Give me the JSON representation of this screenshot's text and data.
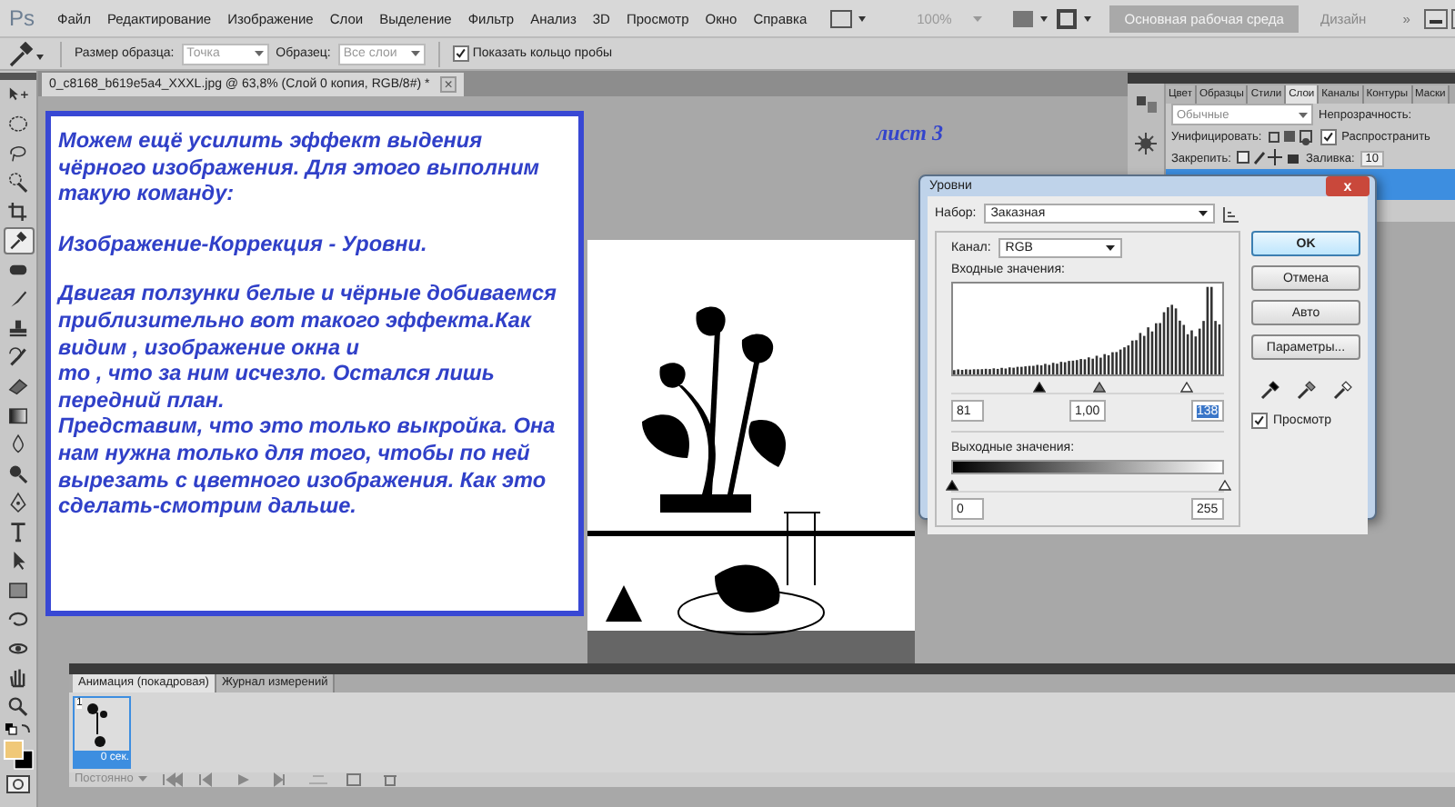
{
  "app_logo": "Ps",
  "menu": [
    "Файл",
    "Редактирование",
    "Изображение",
    "Слои",
    "Выделение",
    "Фильтр",
    "Анализ",
    "3D",
    "Просмотр",
    "Окно",
    "Справка"
  ],
  "zoom_menu": "100%",
  "workspaces": [
    {
      "label": "Основная рабочая среда",
      "selected": true
    },
    {
      "label": "Дизайн",
      "selected": false
    }
  ],
  "more_workspaces": "»",
  "options_bar": {
    "sample_size_label": "Размер образца:",
    "sample_size": "Точка",
    "sample_label": "Образец:",
    "sample": "Все слои",
    "show_ring": {
      "label": "Показать кольцо пробы",
      "checked": true
    }
  },
  "tools": [
    {
      "selected": false
    },
    {
      "selected": false
    },
    {
      "selected": false
    },
    {
      "selected": false
    },
    {
      "selected": false
    },
    {
      "selected": true
    },
    {
      "selected": false
    },
    {
      "selected": false
    },
    {
      "selected": false
    },
    {
      "selected": false
    },
    {
      "selected": false
    },
    {
      "selected": false
    },
    {
      "selected": false
    },
    {
      "selected": false
    },
    {
      "selected": false
    },
    {
      "selected": false
    },
    {
      "selected": false
    },
    {
      "selected": false
    },
    {
      "selected": false
    },
    {
      "selected": false
    },
    {
      "selected": false
    },
    {
      "selected": false
    }
  ],
  "document": {
    "tab_title": "0_c8168_b619e5a4_XXXL.jpg @ 63,8% (Слой 0 копия, RGB/8#) *",
    "close": "×",
    "note_paragraphs": [
      [
        "Можем ещё усилить эффект выдения",
        "чёрного изображения. Для этого выполним",
        "такую команду:"
      ],
      [
        "Изображение-Коррекция - Уровни."
      ],
      [
        " Двигая ползунки белые и чёрные добиваемся",
        "приблизительно вот такого эффекта.Как",
        "видим , изображение окна и",
        "то , что за ним исчезло. Остался лишь",
        "передний план.",
        "Представим, что это только выкройка. Она",
        "нам нужна только для того, чтобы по ней",
        "вырезать с цветного изображения. Как это",
        "сделать-смотрим дальше."
      ]
    ],
    "sheet_label": "лист 3"
  },
  "layers_panel": {
    "tabs": [
      {
        "label": "Цвет",
        "selected": false
      },
      {
        "label": "Образцы",
        "selected": false
      },
      {
        "label": "Стили",
        "selected": false
      },
      {
        "label": "Слои",
        "selected": true
      },
      {
        "label": "Каналы",
        "selected": false
      },
      {
        "label": "Контуры",
        "selected": false
      },
      {
        "label": "Маски",
        "selected": false
      }
    ],
    "blend_mode": "Обычные",
    "opacity_label": "Непрозрачность:",
    "unify_label": "Унифицировать:",
    "propagate": {
      "label": "Распространить",
      "checked": true
    },
    "lock_label": "Закрепить:",
    "fill_label": "Заливка:",
    "fill_value": "10"
  },
  "levels_dialog": {
    "title": "Уровни",
    "close": "x",
    "preset_label": "Набор:",
    "preset": "Заказная",
    "channel_label": "Канал:",
    "channel": "RGB",
    "input_label": "Входные значения:",
    "input_black": "81",
    "input_gamma": "1,00",
    "input_white": "138",
    "output_label": "Выходные значения:",
    "output_black": "0",
    "output_white": "255",
    "input_sliders": [
      {
        "level": 0.32
      },
      {
        "level": 0.54
      },
      {
        "level": 0.86
      }
    ],
    "output_sliders": [
      {
        "level": 0
      },
      {
        "level": 1
      }
    ],
    "buttons": [
      {
        "label": "OK",
        "selected": true
      },
      {
        "label": "Отмена",
        "selected": false
      },
      {
        "label": "Авто",
        "selected": false
      },
      {
        "label": "Параметры...",
        "selected": false
      }
    ],
    "preview": {
      "label": "Просмотр",
      "checked": true
    }
  },
  "animation_panel": {
    "tabs": [
      {
        "label": "Анимация (покадровая)",
        "selected": true
      },
      {
        "label": "Журнал измерений",
        "selected": false
      }
    ],
    "frames": [
      {
        "number": "1",
        "delay": "0 сек.",
        "selected": true
      }
    ],
    "loop": "Постоянно"
  }
}
